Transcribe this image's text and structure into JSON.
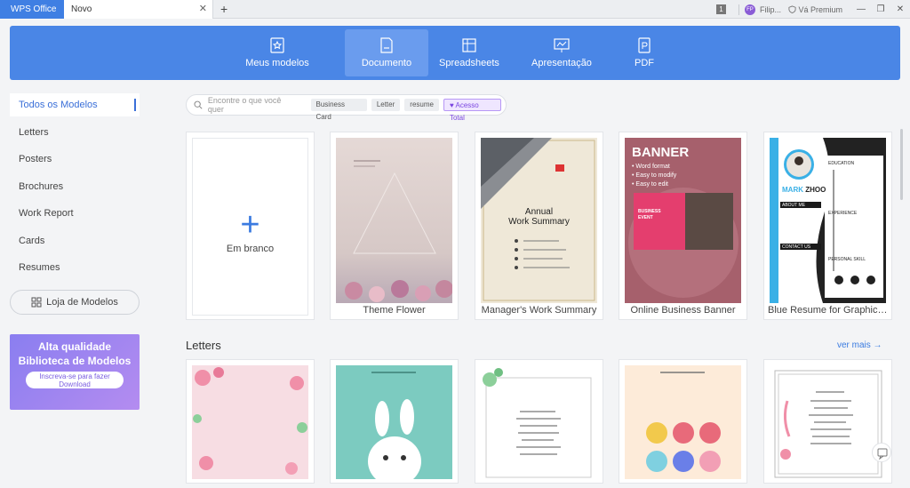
{
  "titlebar": {
    "app_tab": "WPS Office",
    "doc_tab": "Novo",
    "close": "✕",
    "add": "+",
    "badge": "1",
    "avatar_initials": "FP",
    "user": "Filip...",
    "premium": "Vá Premium",
    "controls": [
      "—",
      "❐",
      "✕"
    ]
  },
  "categories": [
    {
      "label": "Meus modelos",
      "icon": "star-doc-icon"
    },
    {
      "label": "Documento",
      "icon": "document-icon",
      "active": true
    },
    {
      "label": "Spreadsheets",
      "icon": "spreadsheet-icon"
    },
    {
      "label": "Apresentação",
      "icon": "presentation-icon"
    },
    {
      "label": "PDF",
      "icon": "pdf-icon"
    }
  ],
  "sidebar": {
    "items": [
      "Todos os Modelos",
      "Letters",
      "Posters",
      "Brochures",
      "Work Report",
      "Cards",
      "Resumes"
    ],
    "store_button": "Loja de Modelos",
    "promo_title": "Alta qualidade Biblioteca de Modelos",
    "promo_button": "Inscreva-se para fazer Download"
  },
  "search": {
    "placeholder": "Encontre o que você quer",
    "chips": [
      "Business Card",
      "Letter",
      "resume"
    ],
    "premium_chip": "Acesso Total"
  },
  "templates": {
    "blank": "Em branco",
    "items": [
      "Theme Flower",
      "Manager's Work Summary",
      "Online Business Banner",
      "Blue Resume for Graphic D..."
    ]
  },
  "thumb_text": {
    "annual": "Annual",
    "work_summary": "Work Summary",
    "banner": "BANNER",
    "banner_lines": [
      "• Word format",
      "• Easy to modify",
      "• Easy to edit"
    ],
    "business": "BUSINESS",
    "event": "EVENT",
    "resume_name_first": "MARK",
    "resume_name_last": "ZHOO",
    "about": "ABOUT ME",
    "contact": "CONTACT US",
    "education": "EDUCATION",
    "experience": "EXPERIENCE",
    "skill": "PERSONAL SKILL"
  },
  "letters_section": {
    "title": "Letters",
    "see_more": "ver mais →"
  },
  "colors": {
    "brand_blue": "#4a86e6",
    "premium_purple": "#8a7ef0"
  }
}
